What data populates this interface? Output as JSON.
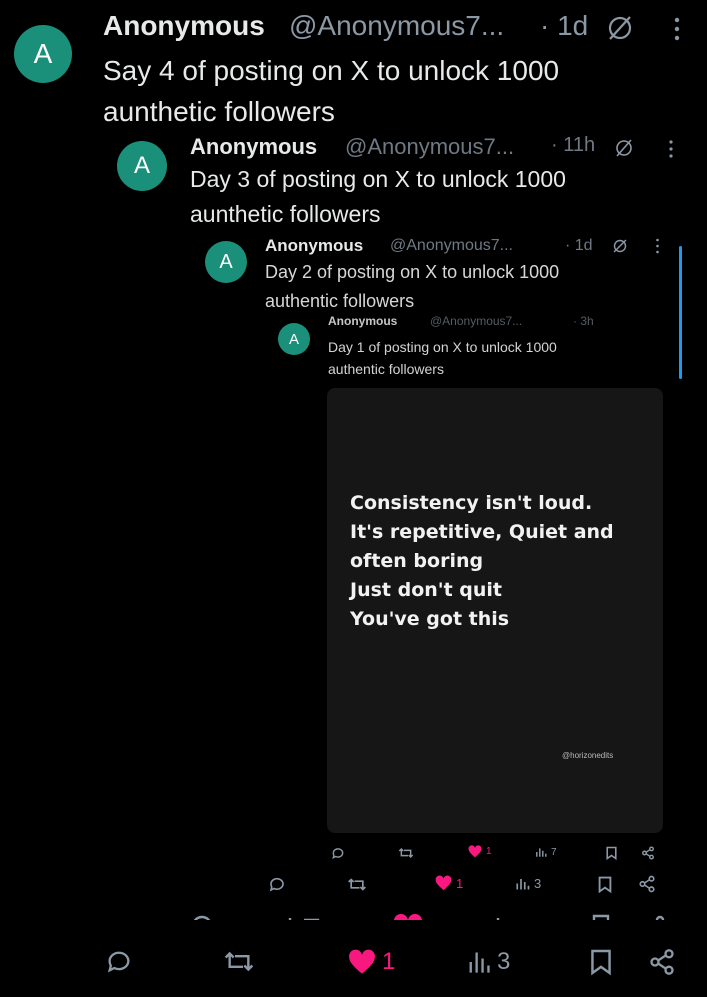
{
  "post4": {
    "avatar_letter": "A",
    "name": "Anonymous",
    "handle": "@Anonymous7...",
    "time": "· 1d",
    "text": "Say 4 of posting on X to unlock 1000\naunthetic followers"
  },
  "post3": {
    "avatar_letter": "A",
    "name": "Anonymous",
    "handle": "@Anonymous7...",
    "time": "· 11h",
    "text": "Day 3 of posting on X to unlock 1000\naunthetic followers"
  },
  "post2": {
    "avatar_letter": "A",
    "name": "Anonymous",
    "handle": "@Anonymous7...",
    "time": "· 1d",
    "text": "Day 2 of posting on X to unlock 1000\nauthentic followers"
  },
  "post1": {
    "avatar_letter": "A",
    "name": "Anonymous",
    "handle": "@Anonymous7...",
    "time": "· 3h",
    "text": "Day 1 of posting on X to unlock 1000\nauthentic followers"
  },
  "image_card": {
    "quote": "Consistency isn't loud.\nIt's repetitive, Quiet and\noften boring\nJust don't quit\nYou've got this",
    "watermark": "@horizonedits"
  },
  "actions_small": {
    "likes": "1",
    "views": "7"
  },
  "actions_mid": {
    "likes": "1",
    "views": "3"
  },
  "actions_main": {
    "likes": "1",
    "views": "3"
  },
  "colors": {
    "accent_like": "#f91880",
    "avatar": "#1a8f7a",
    "text_muted": "#8b98a5"
  }
}
